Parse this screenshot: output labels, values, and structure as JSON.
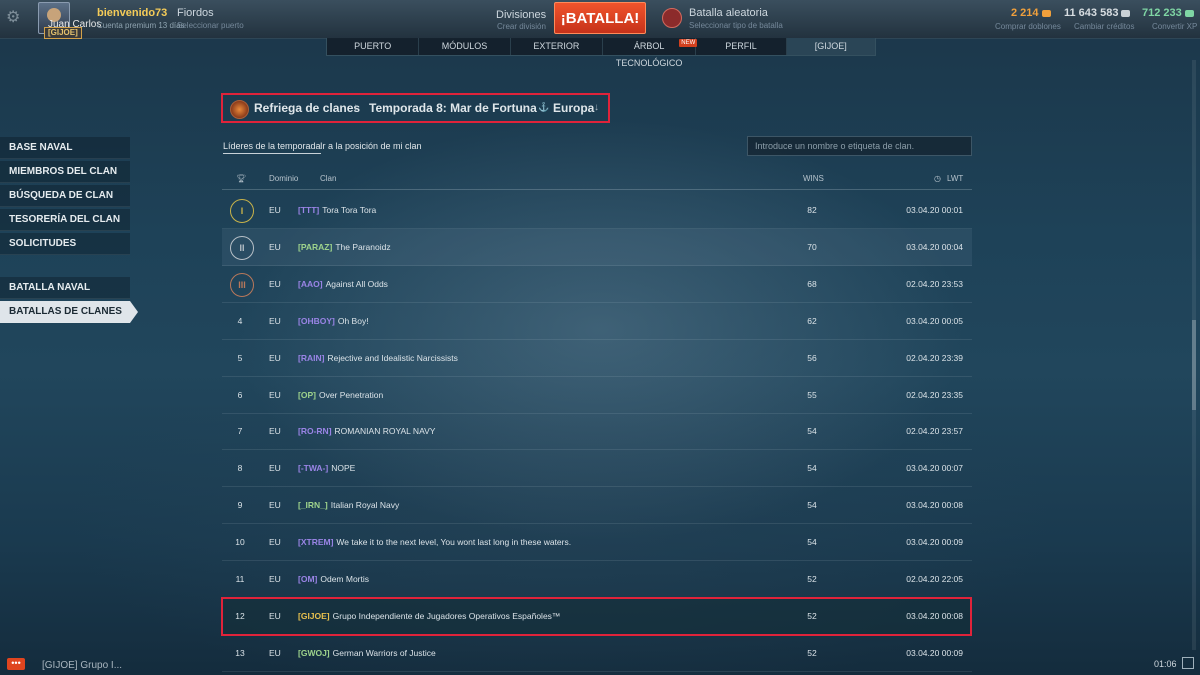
{
  "topbar": {
    "welcome": "bienvenido73",
    "premium": "Cuenta premium 13 días",
    "player_name": "Juan Carlos",
    "clan_tag": "[GIJOE]",
    "port_name": "Fiordos",
    "port_sub": "Seleccionar puerto",
    "divisions_label": "Divisiones",
    "divisions_sub": "Crear división",
    "battle_label": "¡BATALLA!",
    "mode_label": "Batalla aleatoria",
    "mode_sub": "Seleccionar tipo de batalla",
    "doubloons": "2 214",
    "doubloons_sub": "Comprar doblones",
    "credits": "11 643 583",
    "credits_sub": "Cambiar créditos",
    "free_xp": "712 233",
    "free_xp_sub": "Convertir XP",
    "colors": {
      "doubloons": "#f0a03c",
      "credits": "#d7dde1",
      "free_xp": "#7fd6a4",
      "welcome": "#f5cc58"
    }
  },
  "tabs": [
    {
      "label": "PUERTO"
    },
    {
      "label": "MÓDULOS"
    },
    {
      "label": "EXTERIOR"
    },
    {
      "label": "ÁRBOL TECNOLÓGICO",
      "badge": "NEW"
    },
    {
      "label": "PERFIL"
    },
    {
      "label": "[GIJOE]"
    }
  ],
  "sidebar": {
    "items": [
      {
        "label": "BASE NAVAL"
      },
      {
        "label": "MIEMBROS DEL CLAN"
      },
      {
        "label": "BÚSQUEDA DE CLAN"
      },
      {
        "label": "TESORERÍA DEL CLAN"
      },
      {
        "label": "SOLICITUDES"
      },
      {
        "label": "BATALLA NAVAL"
      },
      {
        "label": "BATALLAS DE CLANES"
      }
    ]
  },
  "selectors": {
    "mode": "Refriega de clanes",
    "season": "Temporada 8: Mar de Fortuna",
    "region": "Europa"
  },
  "subheader": {
    "leaders": "Líderes de la temporada",
    "goto": "Ir a la posición de mi clan",
    "search_placeholder": "Introduce un nombre o etiqueta de clan."
  },
  "table": {
    "headers": {
      "domain": "Dominio",
      "clan": "Clan",
      "wins": "WINS",
      "lwt": "LWT"
    },
    "rows": [
      {
        "rank": "I",
        "domain": "EU",
        "tag": "[TTT]",
        "name": "Tora Tora Tora",
        "wins": "82",
        "lwt": "03.04.20 00:01",
        "tag_color": "#9a84e6"
      },
      {
        "rank": "II",
        "domain": "EU",
        "tag": "[PARAZ]",
        "name": "The Paranoidz",
        "wins": "70",
        "lwt": "03.04.20 00:04",
        "tag_color": "#9ed38c"
      },
      {
        "rank": "III",
        "domain": "EU",
        "tag": "[AAO]",
        "name": "Against All Odds",
        "wins": "68",
        "lwt": "02.04.20 23:53",
        "tag_color": "#9a84e6"
      },
      {
        "rank": "4",
        "domain": "EU",
        "tag": "[OHBOY]",
        "name": "Oh Boy!",
        "wins": "62",
        "lwt": "03.04.20 00:05",
        "tag_color": "#9a84e6"
      },
      {
        "rank": "5",
        "domain": "EU",
        "tag": "[RAIN]",
        "name": "Rejective and Idealistic Narcissists",
        "wins": "56",
        "lwt": "02.04.20 23:39",
        "tag_color": "#9a84e6"
      },
      {
        "rank": "6",
        "domain": "EU",
        "tag": "[OP]",
        "name": "Over Penetration",
        "wins": "55",
        "lwt": "02.04.20 23:35",
        "tag_color": "#9ed38c"
      },
      {
        "rank": "7",
        "domain": "EU",
        "tag": "[RO-RN]",
        "name": "ROMANIAN ROYAL NAVY",
        "wins": "54",
        "lwt": "02.04.20 23:57",
        "tag_color": "#9a84e6"
      },
      {
        "rank": "8",
        "domain": "EU",
        "tag": "[-TWA-]",
        "name": "NOPE",
        "wins": "54",
        "lwt": "03.04.20 00:07",
        "tag_color": "#9a84e6"
      },
      {
        "rank": "9",
        "domain": "EU",
        "tag": "[_IRN_]",
        "name": "Italian Royal Navy",
        "wins": "54",
        "lwt": "03.04.20 00:08",
        "tag_color": "#9ed38c"
      },
      {
        "rank": "10",
        "domain": "EU",
        "tag": "[XTREM]",
        "name": "We take it to the next level, You wont last long in these waters.",
        "wins": "54",
        "lwt": "03.04.20 00:09",
        "tag_color": "#9a84e6"
      },
      {
        "rank": "11",
        "domain": "EU",
        "tag": "[OM]",
        "name": "Odem Mortis",
        "wins": "52",
        "lwt": "02.04.20 22:05",
        "tag_color": "#9a84e6"
      },
      {
        "rank": "12",
        "domain": "EU",
        "tag": "[GIJOE]",
        "name": "Grupo Independiente de Jugadores Operativos Españoles™",
        "wins": "52",
        "lwt": "03.04.20 00:08",
        "tag_color": "#e8c14e"
      },
      {
        "rank": "13",
        "domain": "EU",
        "tag": "[GWOJ]",
        "name": "German Warriors of Justice",
        "wins": "52",
        "lwt": "03.04.20 00:09",
        "tag_color": "#9ed38c"
      }
    ]
  },
  "bottom": {
    "clan_label": "[GIJOE] Grupo I...",
    "clock": "01:06"
  },
  "icons": {
    "settings": "gear-icon",
    "trophy": "trophy-icon",
    "clock": "clock-icon",
    "sort": "arrow-down-icon"
  }
}
